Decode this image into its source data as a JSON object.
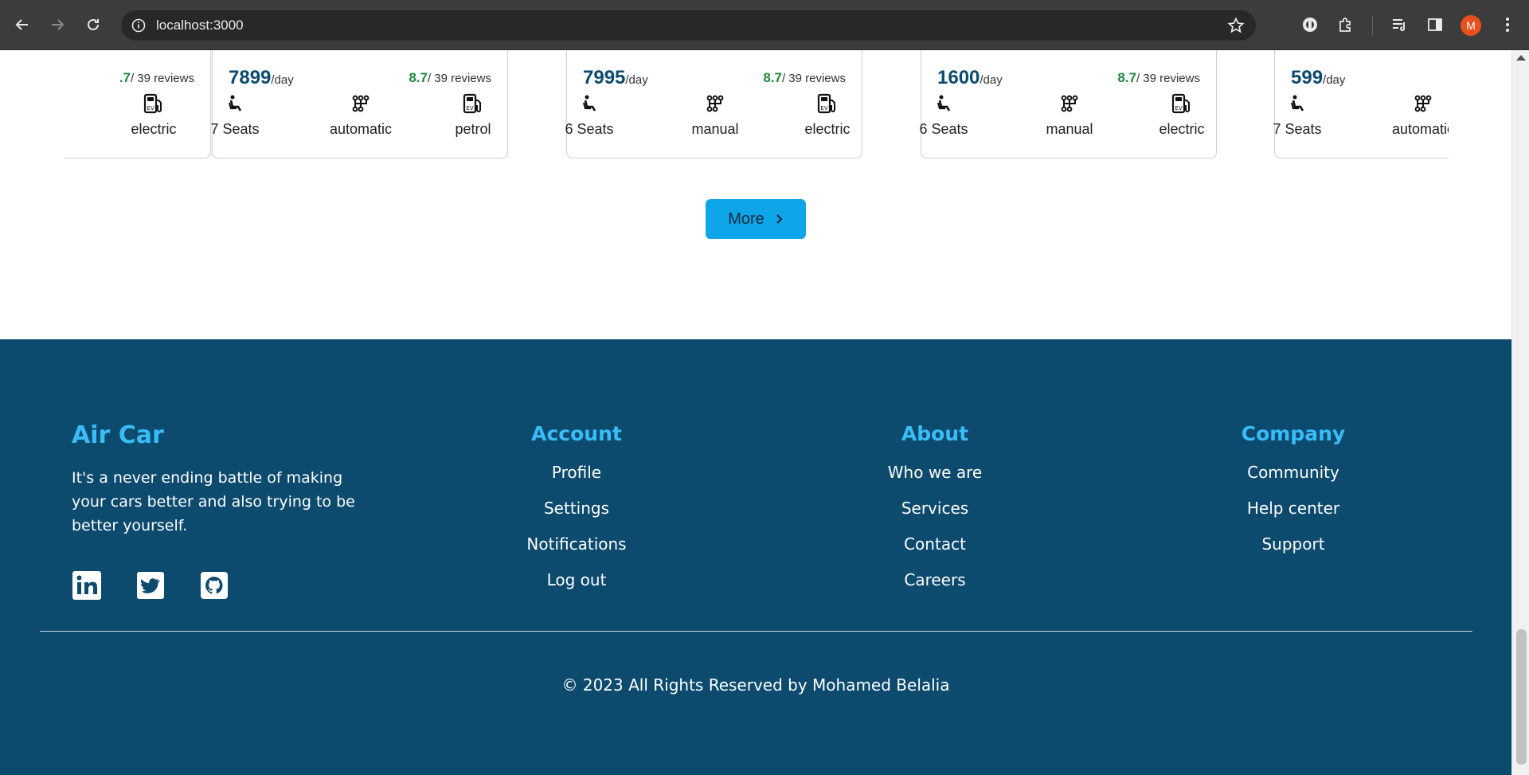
{
  "browser": {
    "url": "localhost:3000",
    "avatar_letter": "M"
  },
  "cars": [
    {
      "price": "",
      "per": "",
      "score": ".7",
      "reviews": "/ 39 reviews",
      "seats": "",
      "transmission": "",
      "fuel": "electric"
    },
    {
      "price": "7899",
      "per": "/day",
      "score": "8.7",
      "reviews": "/ 39 reviews",
      "seats": "7 Seats",
      "transmission": "automatic",
      "fuel": "petrol"
    },
    {
      "price": "7995",
      "per": "/day",
      "score": "8.7",
      "reviews": "/ 39 reviews",
      "seats": "6 Seats",
      "transmission": "manual",
      "fuel": "electric"
    },
    {
      "price": "1600",
      "per": "/day",
      "score": "8.7",
      "reviews": "/ 39 reviews",
      "seats": "6 Seats",
      "transmission": "manual",
      "fuel": "electric"
    },
    {
      "price": "599",
      "per": "/day",
      "score": "",
      "reviews": "",
      "seats": "7 Seats",
      "transmission": "automatic",
      "fuel": ""
    }
  ],
  "more_button": "More",
  "footer": {
    "brand": "Air Car",
    "tagline": "It's a never ending battle of making your cars better and also trying to be better yourself.",
    "columns": [
      {
        "title": "Account",
        "links": [
          "Profile",
          "Settings",
          "Notifications",
          "Log out"
        ]
      },
      {
        "title": "About",
        "links": [
          "Who we are",
          "Services",
          "Contact",
          "Careers"
        ]
      },
      {
        "title": "Company",
        "links": [
          "Community",
          "Help center",
          "Support"
        ]
      }
    ],
    "social_icons": [
      "linkedin-icon",
      "twitter-icon",
      "github-icon"
    ],
    "copyright": "© 2023 All Rights Reserved by Mohamed Belalia"
  },
  "colors": {
    "footer_bg": "#0c4a6e",
    "accent": "#38bdf8",
    "button": "#0ea5e9",
    "price": "#0b4a6f",
    "rating": "#1e8a3c"
  }
}
